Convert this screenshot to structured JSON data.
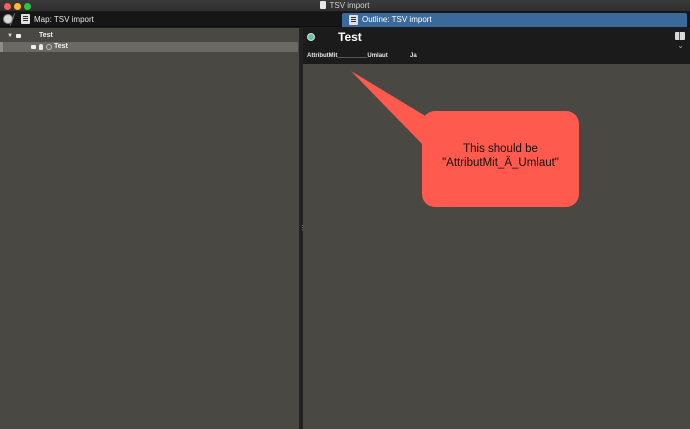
{
  "window": {
    "title": "TSV import"
  },
  "tabs": {
    "map_label": "Map: TSV import",
    "outline_label": "Outline: TSV import"
  },
  "outline_tree": {
    "items": [
      {
        "label": "Test",
        "expanded": true
      },
      {
        "label": "Test",
        "selected": true
      }
    ]
  },
  "outline_view": {
    "title": "Test",
    "attribute_name": "AttributMit_________Umlaut",
    "attribute_value": "Ja",
    "status_color": "#62c3a6"
  },
  "annotation": {
    "line1": "This should be",
    "line2": "\"AttributMit_Ä_Umlaut\"",
    "color": "#ff5a4d"
  }
}
